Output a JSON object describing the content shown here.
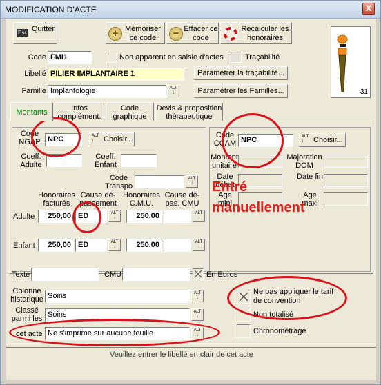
{
  "window": {
    "title": "MODIFICATION D'ACTE",
    "close_glyph": "X"
  },
  "toolbar": {
    "quit_label": "Quitter",
    "quit_key": "Esc",
    "memorize_label": "Mémoriser ce code",
    "erase_label": "Effacer ce code",
    "recalc_label": "Recalculer les honoraires"
  },
  "form": {
    "code_label": "Code",
    "code_value": "FMI1",
    "non_apparent_label": "Non apparent en saisie d'actes",
    "tracabilite_label": "Traçabilité",
    "libelle_label": "Libellé",
    "libelle_value": "PILIER IMPLANTAIRE 1",
    "param_trac_label": "Paramétrer la traçabilité...",
    "famille_label": "Famille",
    "famille_value": "Implantologie",
    "param_fam_label": "Paramétrer les Familles...",
    "tooth_number": "31"
  },
  "tabs": [
    "Montants",
    "Infos complément.",
    "Code graphique",
    "Devis & proposition thérapeutique"
  ],
  "ngap": {
    "code_label": "Code NGAP",
    "code_value": "NPC",
    "choose_label": "Choisir...",
    "coef_adulte_label": "Coeff. Adulte",
    "coef_enfant_label": "Coeff. Enfant",
    "code_transpo_label": "Code Transpo",
    "honoraires_label": "Honoraires facturés",
    "cause_dep_label": "Cause dé-passement",
    "honoraires_cmu_label": "Honoraires C.M.U.",
    "cause_dep_cmu_label": "Cause dé-pas. CMU",
    "adulte_label": "Adulte",
    "adulte_honoraires": "250,00",
    "adulte_cause": "ED",
    "adulte_cmu": "250,00",
    "enfant_label": "Enfant",
    "enfant_honoraires": "250,00",
    "enfant_cause": "ED",
    "enfant_cmu": "250,00"
  },
  "ccam": {
    "code_label": "Code CCAM",
    "code_value": "NPC",
    "choose_label": "Choisir...",
    "montant_label": "Montant unitaire",
    "majoration_label": "Majoration DOM",
    "date_debut_label": "Date début",
    "date_fin_label": "Date fin",
    "age_min_label": "Age mini",
    "age_max_label": "Age maxi"
  },
  "annotation": {
    "line1": "Entré",
    "line2": "manuellement"
  },
  "bottom": {
    "texte_label": "Texte",
    "cmu_label": "CMU",
    "en_euros_label": "En Euros",
    "colonne_label": "Colonne historique",
    "colonne_value": "Soins",
    "classe_label": "Classé parmi les",
    "classe_value": "Soins",
    "cet_acte_label": "cet acte",
    "cet_acte_value": "Ne s'imprime sur aucune feuille",
    "ne_pas_appliquer_label": "Ne pas appliquer le tarif de convention",
    "non_totalise_label": "Non totalisé",
    "chrono_label": "Chronométrage",
    "alt_label": "ALT"
  },
  "status": {
    "message": "Veuillez entrer le libellé en clair de cet acte"
  },
  "colors": {
    "accent_red": "#d9131b",
    "tab_green": "#008000",
    "libelle_bg": "#ffffc8"
  }
}
